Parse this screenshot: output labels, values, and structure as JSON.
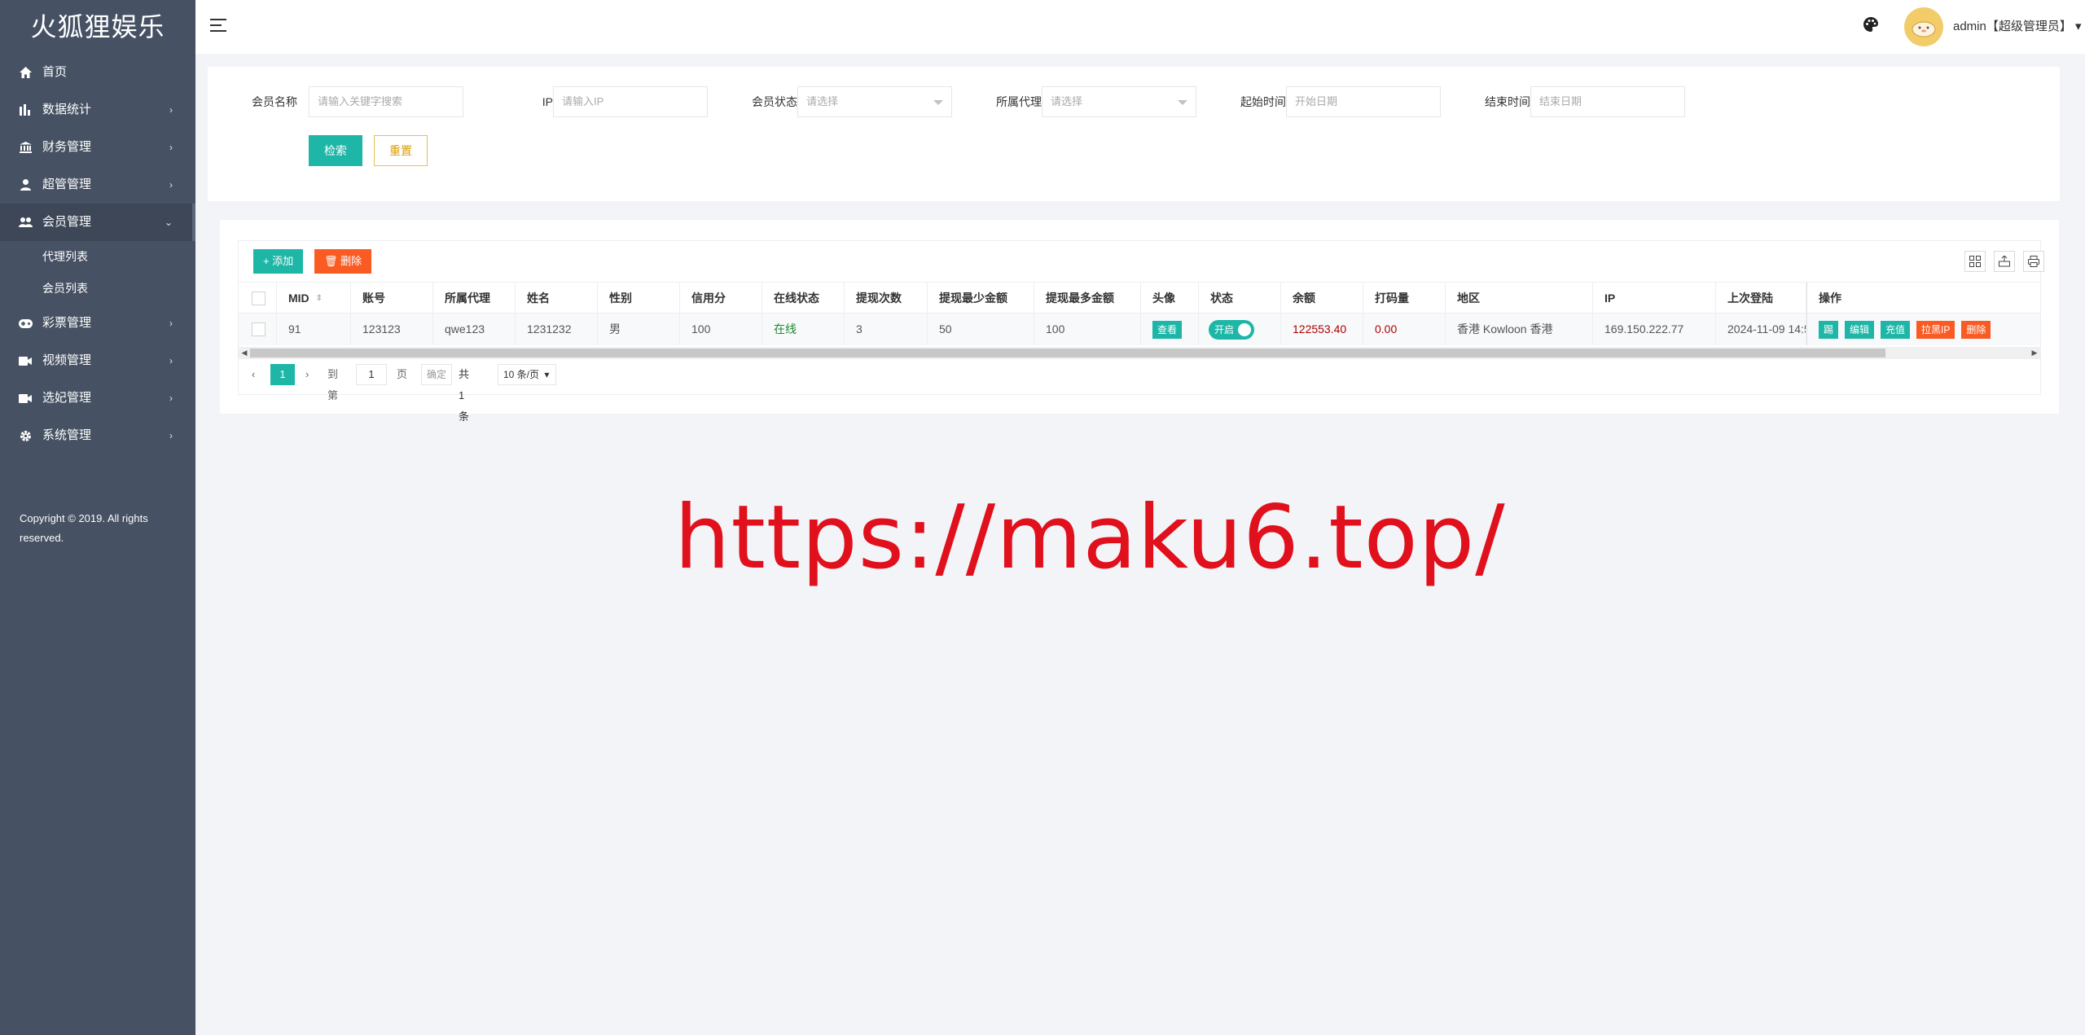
{
  "app": {
    "logo": "火狐狸娱乐"
  },
  "sidebar": {
    "items": [
      {
        "label": "首页",
        "icon": "home-icon"
      },
      {
        "label": "数据统计",
        "icon": "bar-chart-icon",
        "arrow": "›"
      },
      {
        "label": "财务管理",
        "icon": "bank-icon",
        "arrow": "›"
      },
      {
        "label": "超管管理",
        "icon": "user-icon",
        "arrow": "›"
      },
      {
        "label": "会员管理",
        "icon": "users-icon",
        "arrow": "›"
      },
      {
        "label": "彩票管理",
        "icon": "gamepad-icon",
        "arrow": "›"
      },
      {
        "label": "视频管理",
        "icon": "video-icon",
        "arrow": "›"
      },
      {
        "label": "选妃管理",
        "icon": "video-icon",
        "arrow": "›"
      },
      {
        "label": "系统管理",
        "icon": "gear-icon",
        "arrow": "›"
      }
    ],
    "submenu": [
      "代理列表",
      "会员列表"
    ],
    "copyright": "Copyright © 2019. All rights reserved."
  },
  "header": {
    "user": "admin【超级管理员】",
    "caret": "▾"
  },
  "search": {
    "fields": [
      {
        "label": "会员名称",
        "placeholder": "请输入关键字搜索"
      },
      {
        "label": "IP",
        "placeholder": "请输入IP"
      },
      {
        "label": "会员状态",
        "placeholder": "请选择"
      },
      {
        "label": "所属代理",
        "placeholder": "请选择"
      },
      {
        "label": "起始时间",
        "placeholder": "开始日期"
      },
      {
        "label": "结束时间",
        "placeholder": "结束日期"
      }
    ],
    "search_btn": "检索",
    "reset_btn": "重置"
  },
  "toolbar": {
    "add": "+ 添加",
    "delete": "🗑 删除"
  },
  "table": {
    "headers": [
      "MID",
      "账号",
      "所属代理",
      "姓名",
      "性别",
      "信用分",
      "在线状态",
      "提现次数",
      "提现最少金额",
      "提现最多金额",
      "头像",
      "状态",
      "余额",
      "打码量",
      "地区",
      "IP",
      "上次登陆",
      "操作"
    ],
    "sort_icon": "⇕",
    "row": {
      "mid": "91",
      "account": "123123",
      "agent": "qwe123",
      "name": "1231232",
      "gender": "男",
      "credit": "100",
      "online": "在线",
      "withdraw_count": "3",
      "withdraw_min": "50",
      "withdraw_max": "100",
      "avatar_btn": "查看",
      "status_switch": "开启",
      "balance": "122553.40",
      "bet_amount": "0.00",
      "region": "香港 Kowloon 香港",
      "ip": "169.150.222.77",
      "last_login": "2024-11-09 14:5",
      "actions": [
        "踢",
        "编辑",
        "充值",
        "拉黑IP",
        "删除"
      ]
    },
    "colors": {
      "online": "#1e8a2e",
      "money": "#b00000"
    }
  },
  "pager": {
    "prev": "‹",
    "current": "1",
    "next": "›",
    "goto_label": "到第",
    "goto_value": "1",
    "page_label": "页",
    "confirm": "确定",
    "total": "共 1 条",
    "page_size": "10 条/页"
  },
  "watermark": "https://maku6.top/"
}
